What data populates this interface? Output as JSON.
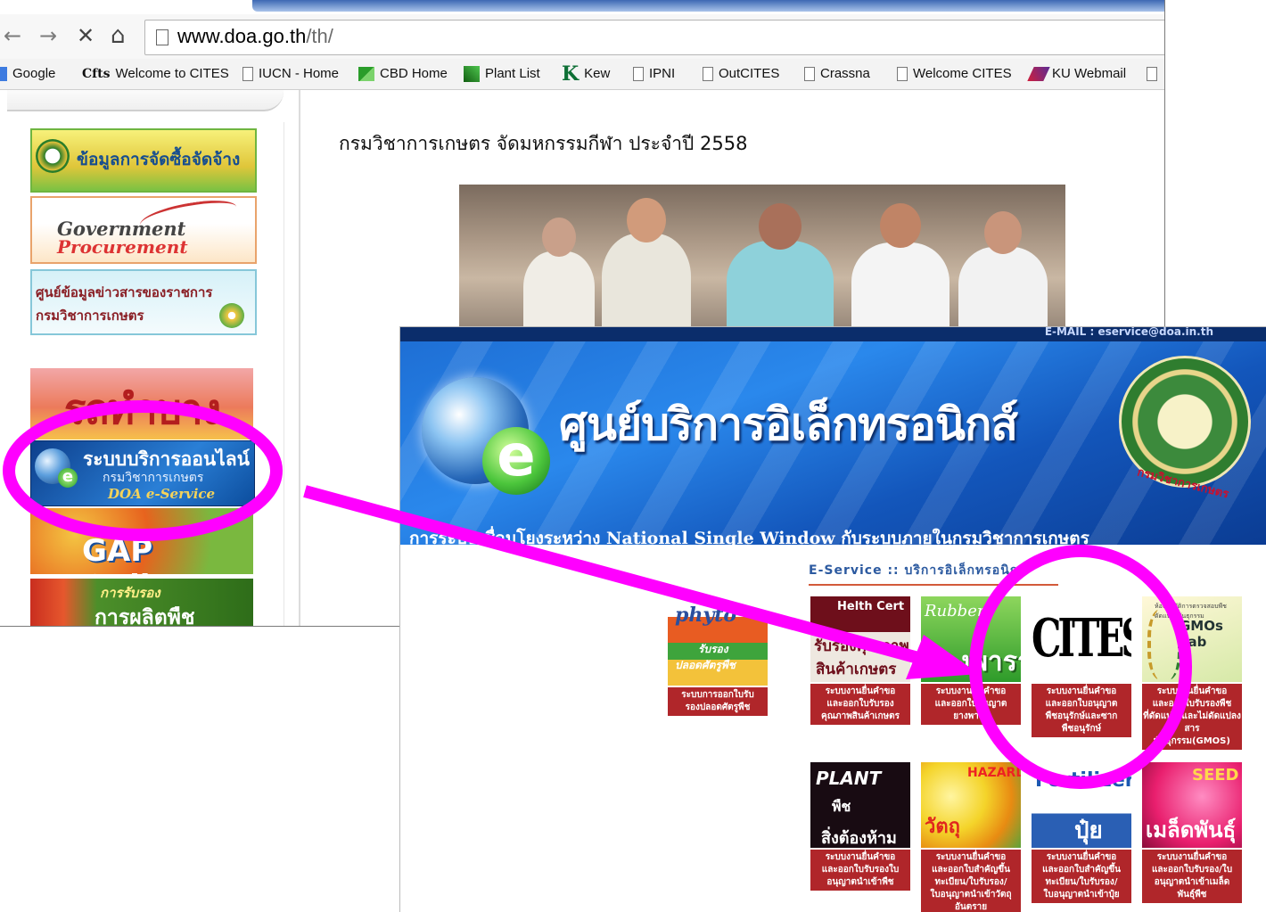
{
  "browser": {
    "nav": {
      "back": "←",
      "forward": "→",
      "stop": "✕",
      "home": "⌂"
    },
    "url": {
      "host": "www.doa.go.th",
      "path": "/th/"
    },
    "bookmarks": [
      {
        "label": "Google",
        "icon": "google-icon"
      },
      {
        "label": "Welcome to CITES",
        "icon": "cites-icon",
        "prefix": "Cfts"
      },
      {
        "label": "IUCN - Home",
        "icon": "page-icon"
      },
      {
        "label": "CBD Home",
        "icon": "cbd-icon"
      },
      {
        "label": "Plant List",
        "icon": "plant-list-icon"
      },
      {
        "label": "Kew",
        "icon": "kew-icon",
        "prefix": "K"
      },
      {
        "label": "IPNI",
        "icon": "page-icon"
      },
      {
        "label": "OutCITES",
        "icon": "page-icon"
      },
      {
        "label": "Crassna",
        "icon": "page-icon"
      },
      {
        "label": "Welcome CITES",
        "icon": "page-icon"
      },
      {
        "label": "KU Webmail",
        "icon": "ku-webmail-icon"
      }
    ]
  },
  "sidebar": {
    "procurement_banner": "ข้อมูลการจัดซื้อจัดจ้าง",
    "gov_procurement": {
      "line1": "Government",
      "line2": "Procurement"
    },
    "info_center": {
      "line1": "ศูนย์ข้อมูลข่าวสารของราชการ",
      "line2": "กรมวิชาการเกษตร"
    },
    "red_banner": "รถทำบาง",
    "eservice": {
      "line1": "ระบบบริการออนไลน์",
      "line2": "กรมวิชาการเกษตร",
      "line3": "DOA e-Service"
    },
    "gap_banner": "GAP Online",
    "organic": {
      "line1": "การรับรอง",
      "line2": "การผลิตพืชอินทรีย์"
    }
  },
  "main": {
    "news_title": "กรมวิชาการเกษตร จัดมหกรรมกีฬา ประจำปี 2558"
  },
  "eservice_page": {
    "email": "E-MAIL : eservice@doa.in.th",
    "title": "ศูนย์บริการอิเล็กทรอนิกส์",
    "seal_text": "กรมวิชาการเกษตร",
    "tagline": "การระบบเชื่อมโยงระหว่าง National Single Window กับระบบภายในกรมวิชาการเกษตร",
    "section_header": "E-Service :: บริการอิเล็กทรอนิกส์",
    "tiles_row1": [
      {
        "id": "t-phyto",
        "title": "phyto",
        "sub1": "รับรอง",
        "sub2": "ปลอดศัตรูพืช",
        "caption": [
          "ระบบการออกใบรับ",
          "รองปลอดศัตรูพืช"
        ]
      },
      {
        "id": "t-health",
        "title": "Helth Cert",
        "sub1": "รับรองคุณภาพ",
        "sub2": "สินค้าเกษตร",
        "caption": [
          "ระบบงานยื่นคำขอ",
          "และออกใบรับรอง",
          "คุณภาพสินค้าเกษตร"
        ]
      },
      {
        "id": "t-rubber",
        "title": "Rubber",
        "sub1": "ยางพารา",
        "caption": [
          "ระบบงานยื่นคำขอ",
          "และออกใบอนุญาต",
          "ยางพารา"
        ]
      },
      {
        "id": "t-cites",
        "title": "CITES",
        "caption": [
          "ระบบงานยื่นคำขอ",
          "และออกใบอนุญาต",
          "พืชอนุรักษ์และซาก",
          "พืชอนุรักษ์"
        ]
      },
      {
        "id": "t-gmos",
        "title": "GMOs Lab",
        "sub1": "ห้องปฏิบัติการตรวจสอบพืชดัดแปลงพันธุกรรม",
        "caption": [
          "ระบบงานยื่นคำขอ",
          "และออกใบรับรองพืช",
          "ที่ดัดแปลงและไม่ดัดแปลง",
          "สาร",
          "พันธุกรรม(GMOS)"
        ]
      }
    ],
    "tiles_row2": [
      {
        "id": "t-plant",
        "title": "PLANT",
        "sub1": "พืช",
        "sub2": "สิ่งต้องห้าม",
        "caption": [
          "ระบบงานยื่นคำขอ",
          "และออกใบรับรองใบ",
          "อนุญาตนำเข้าพืช"
        ]
      },
      {
        "id": "t-hazard",
        "title": "HAZARD",
        "sub1": "วัตถุอันตราย",
        "caption": [
          "ระบบงานยื่นคำขอ",
          "และออกใบสำคัญขึ้น",
          "ทะเบียน/ใบรับรอง/",
          "ใบอนุญาตนำเข้าวัตถุ",
          "อันตราย"
        ]
      },
      {
        "id": "t-fert",
        "title": "Fertilizer",
        "sub1": "ปุ๋ย",
        "caption": [
          "ระบบงานยื่นคำขอ",
          "และออกใบสำคัญขึ้น",
          "ทะเบียน/ใบรับรอง/",
          "ใบอนุญาตนำเข้าปุ๋ย"
        ]
      },
      {
        "id": "t-seed",
        "title": "SEED",
        "sub1": "เมล็ดพันธุ์พืช",
        "caption": [
          "ระบบงานยื่นคำขอ",
          "และออกใบรับรอง/ใบ",
          "อนุญาตนำเข้าเมล็ด",
          "พันธุ์พืช"
        ]
      }
    ]
  },
  "annotation": {
    "color": "#ff00ff"
  }
}
